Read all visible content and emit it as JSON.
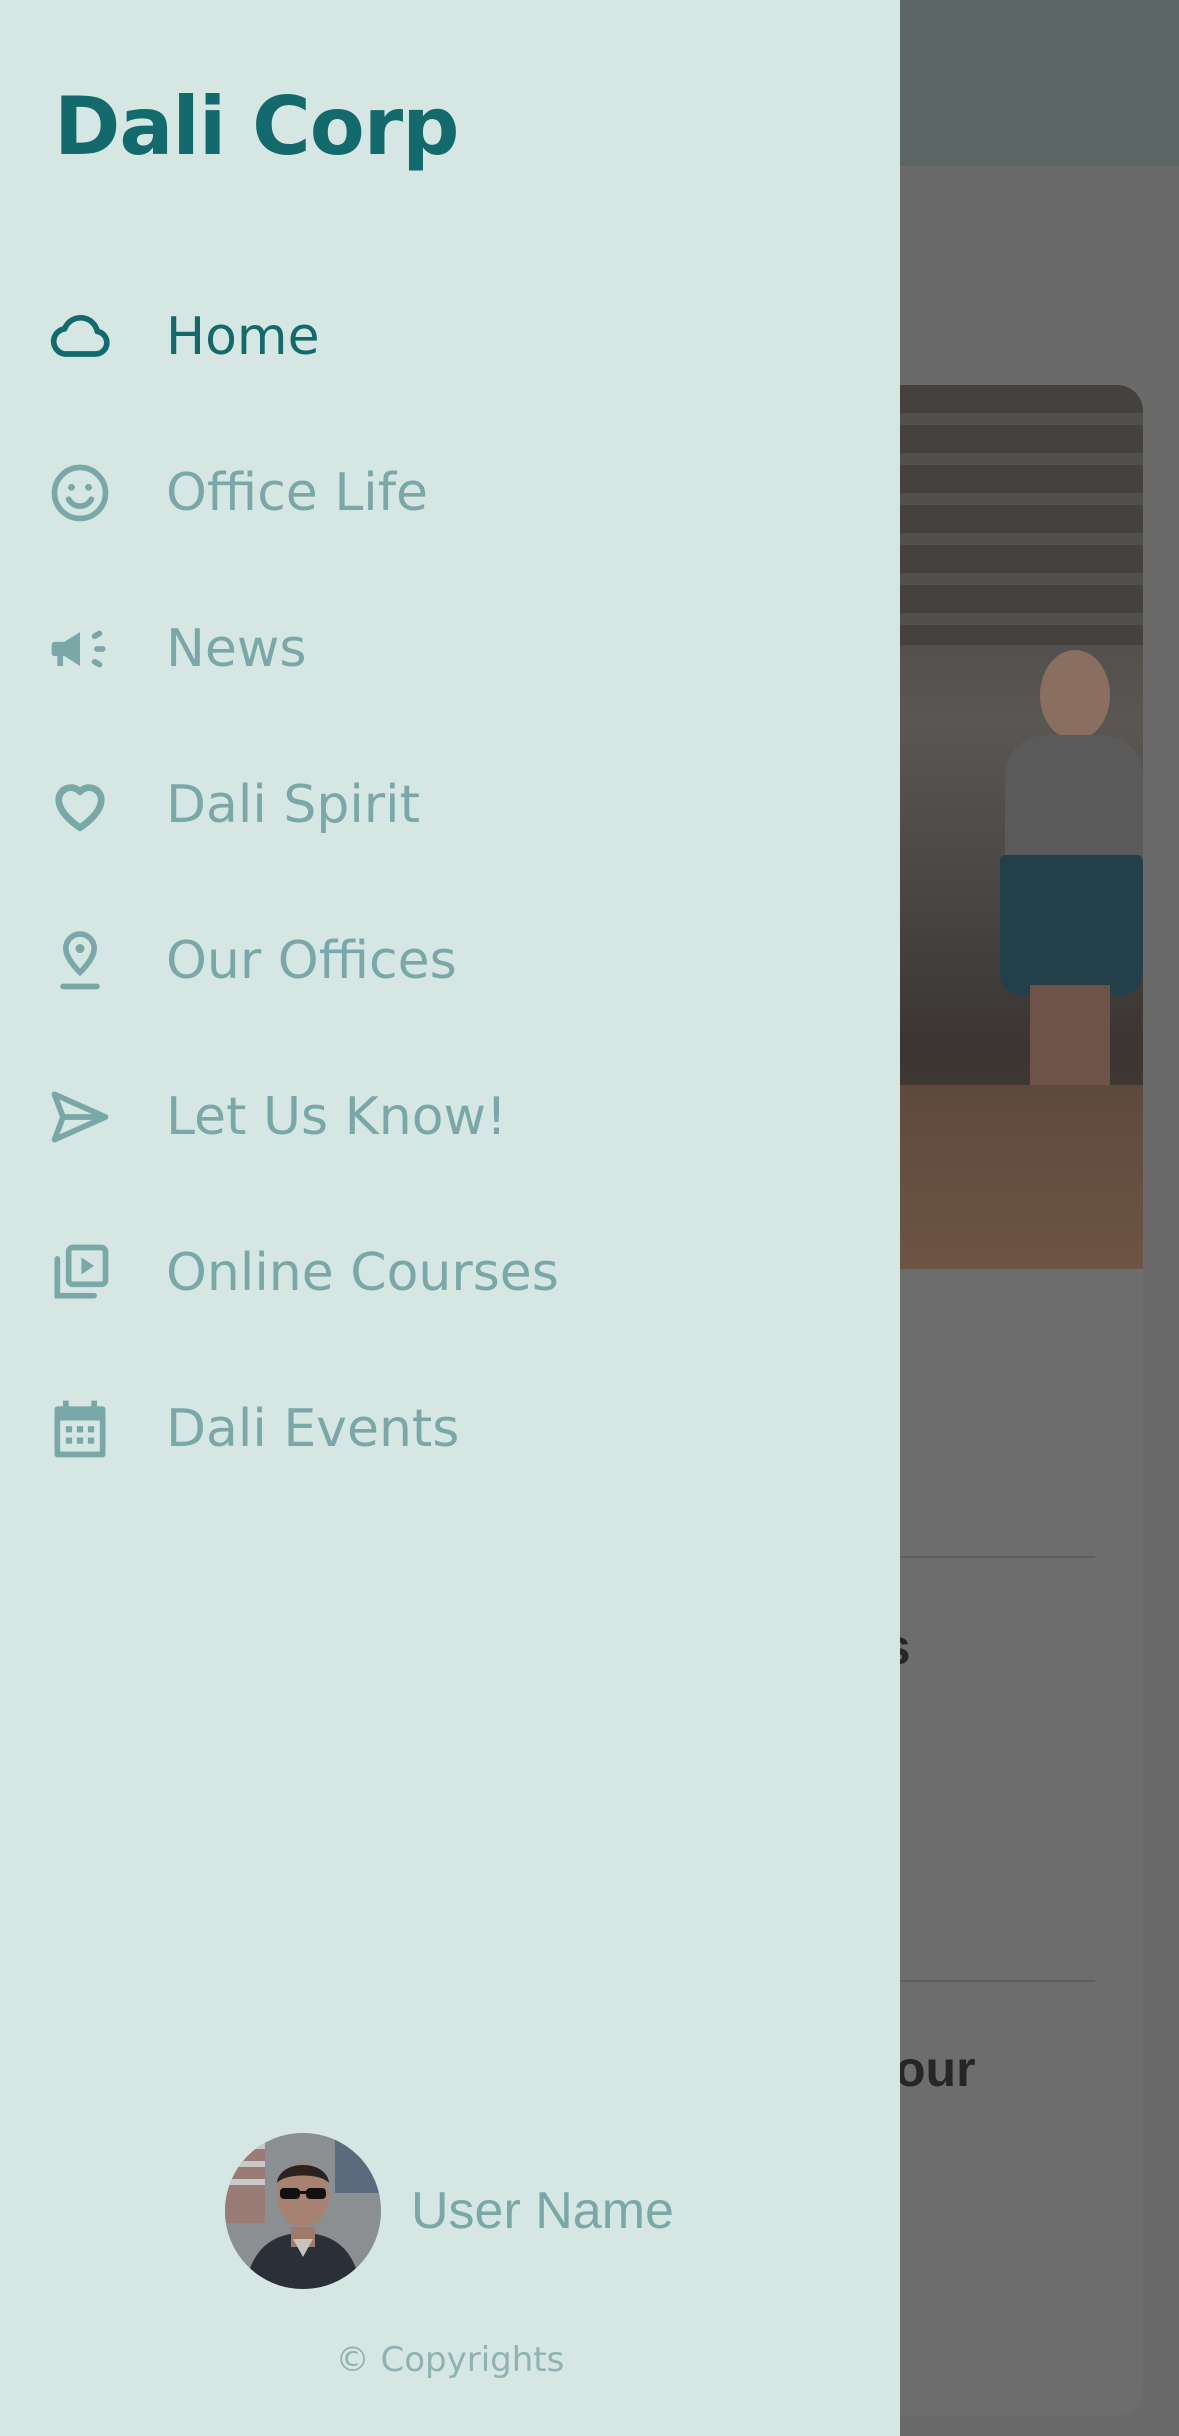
{
  "app": {
    "brand_title": "Dali Corp"
  },
  "menu": {
    "items": [
      {
        "label": "Home",
        "icon": "cloud-icon",
        "active": true
      },
      {
        "label": "Office Life",
        "icon": "smiley-icon",
        "active": false
      },
      {
        "label": "News",
        "icon": "megaphone-icon",
        "active": false
      },
      {
        "label": "Dali Spirit",
        "icon": "heart-icon",
        "active": false
      },
      {
        "label": "Our Offices",
        "icon": "location-pin-icon",
        "active": false
      },
      {
        "label": "Let Us Know!",
        "icon": "send-icon",
        "active": false
      },
      {
        "label": "Online Courses",
        "icon": "video-library-icon",
        "active": false
      },
      {
        "label": "Dali Events",
        "icon": "calendar-icon",
        "active": false
      }
    ]
  },
  "user": {
    "name": "User Name"
  },
  "footer": {
    "copyright": "© Copyrights"
  },
  "background": {
    "partial_heading_1": "es",
    "partial_heading_2": "our"
  },
  "colors": {
    "drawer_background": "#d6e6e3",
    "accent": "#126a6d",
    "inactive": "#7aa8a8"
  }
}
